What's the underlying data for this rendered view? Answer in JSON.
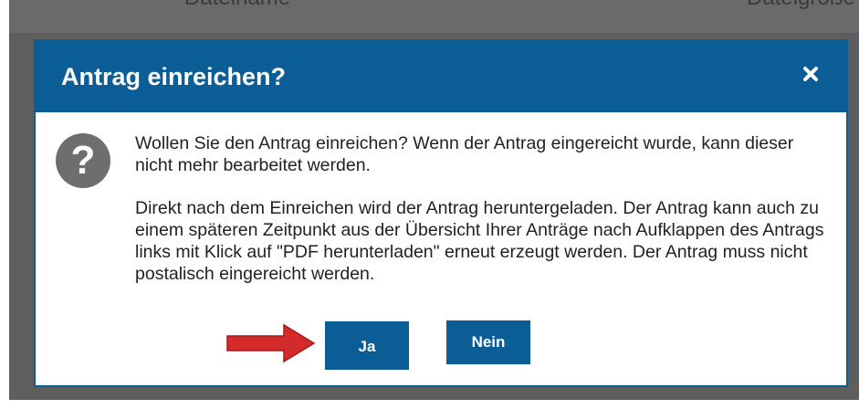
{
  "background": {
    "columns": [
      "Dateiname",
      "Dateigröße"
    ]
  },
  "dialog": {
    "title": "Antrag einreichen?",
    "close_symbol": "×",
    "icon": "question-circle-icon",
    "paragraphs": [
      "Wollen Sie den Antrag einreichen? Wenn der Antrag eingereicht wurde, kann dieser nicht mehr bearbeitet werden.",
      "Direkt nach dem Einreichen wird der Antrag heruntergeladen. Der Antrag kann auch zu einem späteren Zeitpunkt aus der Übersicht Ihrer Anträge nach Aufklappen des Antrags links mit Klick auf \"PDF herunterladen\" erneut erzeugt werden. Der Antrag muss nicht postalisch eingereicht werden."
    ],
    "buttons": {
      "yes": "Ja",
      "no": "Nein"
    }
  },
  "colors": {
    "primary": "#0b5d96",
    "overlay": "#5e5e5e",
    "arrow": "#d42a2a",
    "icon": "#6e6e6e"
  }
}
